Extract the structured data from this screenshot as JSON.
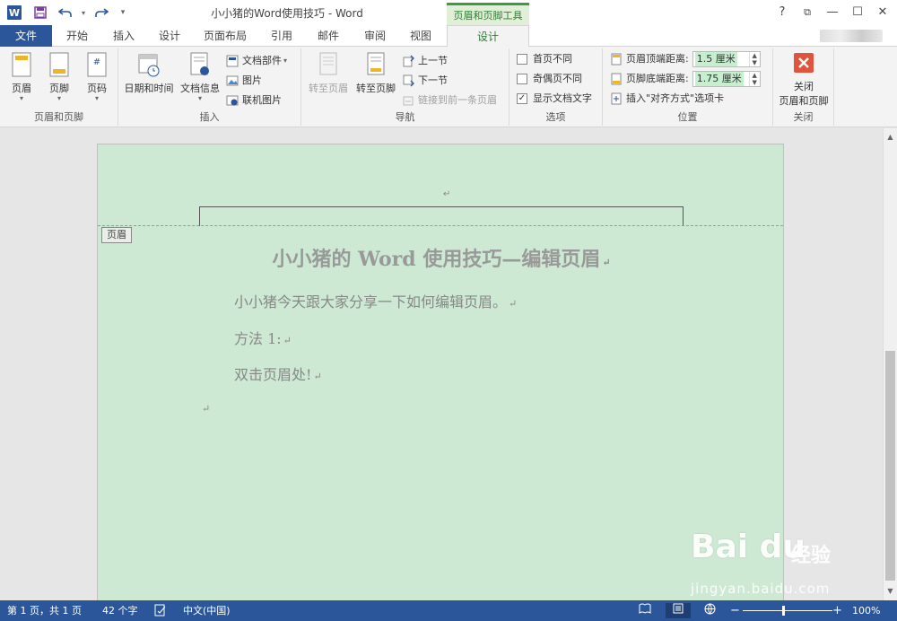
{
  "titlebar": {
    "title": "小小猪的Word使用技巧 - Word",
    "context_tab": "页眉和页脚工具",
    "help": "?",
    "restore": "⧉",
    "minimize": "—",
    "maximize": "☐",
    "close": "✕"
  },
  "tabs": {
    "file": "文件",
    "home": "开始",
    "insert": "插入",
    "design1": "设计",
    "layout": "页面布局",
    "references": "引用",
    "mailings": "邮件",
    "review": "审阅",
    "view": "视图",
    "design": "设计"
  },
  "ribbon": {
    "group1": {
      "label": "页眉和页脚",
      "header": "页眉",
      "footer": "页脚",
      "page_number": "页码"
    },
    "group2": {
      "label": "插入",
      "date_time": "日期和时间",
      "doc_info": "文档信息",
      "doc_parts": "文档部件",
      "picture": "图片",
      "online_picture": "联机图片"
    },
    "group3": {
      "label": "导航",
      "goto_header": "转至页眉",
      "goto_footer": "转至页脚",
      "prev_section": "上一节",
      "next_section": "下一节",
      "link_prev": "链接到前一条页眉"
    },
    "group4": {
      "label": "选项",
      "diff_first": "首页不同",
      "diff_odd_even": "奇偶页不同",
      "show_doc_text": "显示文档文字"
    },
    "group5": {
      "label": "位置",
      "header_top_label": "页眉顶端距离:",
      "header_top_value": "1.5 厘米",
      "footer_bottom_label": "页脚底端距离:",
      "footer_bottom_value": "1.75 厘米",
      "insert_align_tab": "插入\"对齐方式\"选项卡"
    },
    "group6": {
      "label": "关闭",
      "close_line1": "关闭",
      "close_line2": "页眉和页脚"
    }
  },
  "document": {
    "header_tag": "页眉",
    "heading": "小小猪的 Word 使用技巧—编辑页眉",
    "paragraphs": [
      "小小猪今天跟大家分享一下如何编辑页眉。",
      "方法 1:",
      "双击页眉处!"
    ],
    "para_mark": "↵"
  },
  "statusbar": {
    "page": "第 1 页，共 1 页",
    "words": "42 个字",
    "language": "中文(中国)",
    "zoom": "100%",
    "zoom_minus": "−",
    "zoom_plus": "+"
  },
  "watermark": {
    "logo": "Bai du",
    "jingyan": "经验",
    "url": "jingyan.baidu.com"
  },
  "colors": {
    "accent": "#2b579a",
    "context_green": "#3f9b3f",
    "page_bg": "#cde8d3"
  }
}
